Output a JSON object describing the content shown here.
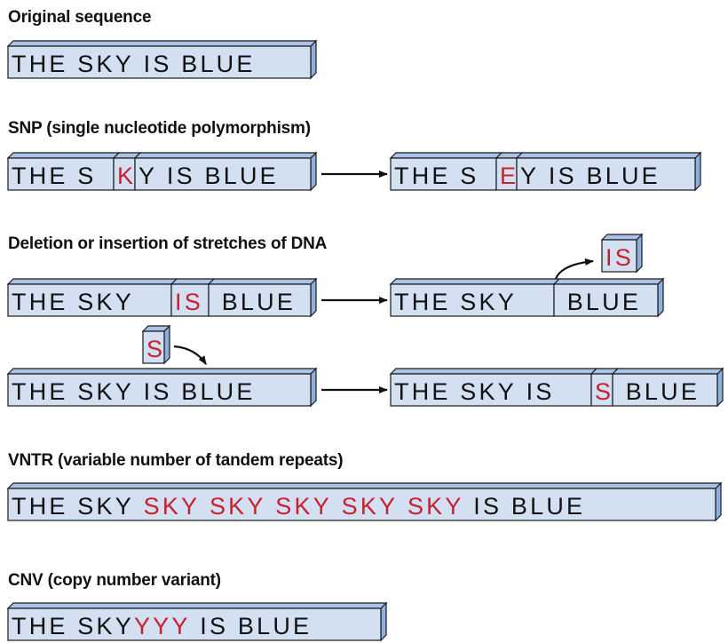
{
  "colors": {
    "front": "#d3e0f2",
    "top": "#a9c2e6",
    "side": "#8fb0de",
    "outline": "#1a1a1a",
    "text": "#111111",
    "highlight": "#c8202e"
  },
  "sections": [
    {
      "id": "original",
      "heading": "Original sequence",
      "diagrams": [
        {
          "segments": [
            [
              {
                "t": "THE SKY IS BLUE",
                "c": "n"
              }
            ]
          ]
        }
      ]
    },
    {
      "id": "snp",
      "heading": "SNP (single nucleotide polymorphism)",
      "diagrams": [
        {
          "segments": [
            [
              {
                "t": "THE S",
                "c": "n"
              }
            ],
            [
              {
                "t": "K",
                "c": "h"
              }
            ],
            [
              {
                "t": "Y IS BLUE",
                "c": "n"
              }
            ]
          ]
        },
        {
          "segments": [
            [
              {
                "t": "THE S",
                "c": "n"
              }
            ],
            [
              {
                "t": "E",
                "c": "h"
              }
            ],
            [
              {
                "t": "Y IS BLUE",
                "c": "n"
              }
            ]
          ]
        }
      ]
    },
    {
      "id": "indel",
      "heading": "Deletion or insertion of stretches of DNA",
      "diagrams": [
        {
          "segments": [
            [
              {
                "t": "THE SKY ",
                "c": "n"
              }
            ],
            [
              {
                "t": "IS",
                "c": "h"
              }
            ],
            [
              {
                "t": " BLUE",
                "c": "n"
              }
            ]
          ]
        },
        {
          "segments": [
            [
              {
                "t": "THE SKY ",
                "c": "n"
              }
            ],
            [
              {
                "t": " BLUE",
                "c": "n"
              }
            ]
          ]
        },
        {
          "floating": true,
          "segments": [
            [
              {
                "t": "IS",
                "c": "h"
              }
            ]
          ]
        },
        {
          "floating": true,
          "segments": [
            [
              {
                "t": "S",
                "c": "h"
              }
            ]
          ]
        },
        {
          "segments": [
            [
              {
                "t": "THE SKY IS BLUE",
                "c": "n"
              }
            ]
          ]
        },
        {
          "segments": [
            [
              {
                "t": "THE SKY IS",
                "c": "n"
              }
            ],
            [
              {
                "t": "S",
                "c": "h"
              }
            ],
            [
              {
                "t": " BLUE",
                "c": "n"
              }
            ]
          ]
        }
      ]
    },
    {
      "id": "vntr",
      "heading": "VNTR (variable number of tandem repeats)",
      "diagrams": [
        {
          "segments": [
            [
              {
                "t": "THE SKY ",
                "c": "n"
              },
              {
                "t": "SKY SKY SKY SKY SKY",
                "c": "h"
              },
              {
                "t": " IS BLUE",
                "c": "n"
              }
            ]
          ]
        }
      ]
    },
    {
      "id": "cnv",
      "heading": "CNV (copy number variant)",
      "diagrams": [
        {
          "segments": [
            [
              {
                "t": "THE SKY",
                "c": "n"
              },
              {
                "t": "YYY",
                "c": "h"
              },
              {
                "t": " IS BLUE",
                "c": "n"
              }
            ]
          ]
        }
      ]
    }
  ]
}
